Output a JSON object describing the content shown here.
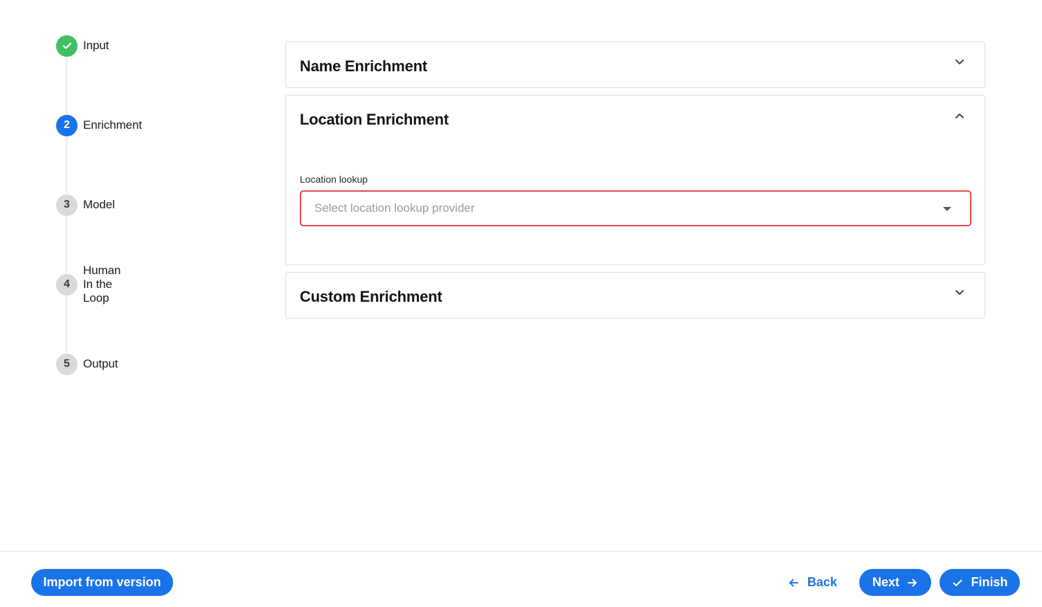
{
  "stepper": {
    "steps": [
      {
        "number": "",
        "label": "Input",
        "state": "done"
      },
      {
        "number": "2",
        "label": "Enrichment",
        "state": "active"
      },
      {
        "number": "3",
        "label": "Model",
        "state": "pending"
      },
      {
        "number": "4",
        "label": "Human In the Loop",
        "state": "pending"
      },
      {
        "number": "5",
        "label": "Output",
        "state": "pending"
      }
    ]
  },
  "panels": {
    "name": {
      "title": "Name Enrichment",
      "expanded": false
    },
    "location": {
      "title": "Location Enrichment",
      "expanded": true,
      "field_label": "Location lookup",
      "select_placeholder": "Select location lookup provider",
      "select_value": ""
    },
    "custom": {
      "title": "Custom Enrichment",
      "expanded": false
    }
  },
  "footer": {
    "import_label": "Import from version",
    "back_label": "Back",
    "next_label": "Next",
    "finish_label": "Finish"
  },
  "colors": {
    "primary": "#1a73e8",
    "done": "#3fbf63",
    "error_border": "#e5484d",
    "pending": "#d9d9d9"
  }
}
